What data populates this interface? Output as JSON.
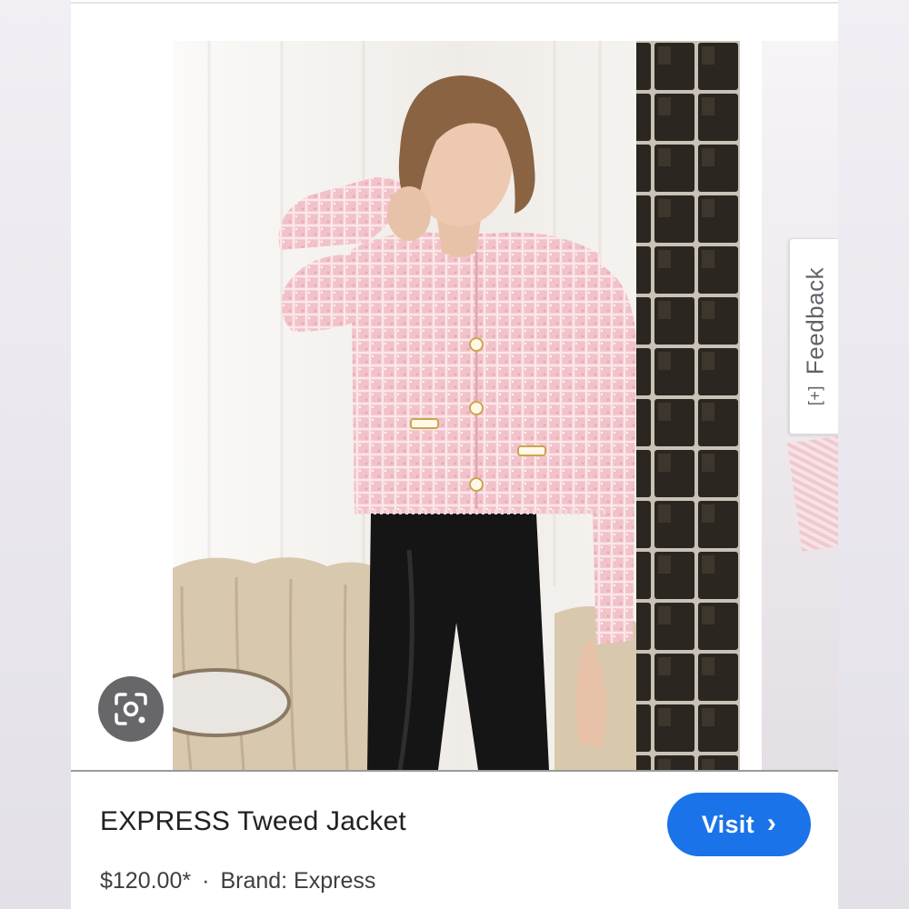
{
  "product": {
    "title": "EXPRESS Tweed Jacket",
    "price": "$120.00*",
    "separator": "·",
    "brand": "Brand: Express",
    "image_alt": "Model wearing pink tweed jacket and black pants"
  },
  "actions": {
    "visit_label": "Visit",
    "visit_icon": "chevron-right-icon",
    "lens_icon": "google-lens-icon"
  },
  "feedback": {
    "label": "Feedback",
    "icon": "feedback-plus-icon",
    "icon_glyph": "[+]"
  },
  "colors": {
    "accent": "#1a73e8",
    "text_primary": "#202124",
    "text_secondary": "#3c4043",
    "jacket_pink": "#f0bcc4"
  }
}
